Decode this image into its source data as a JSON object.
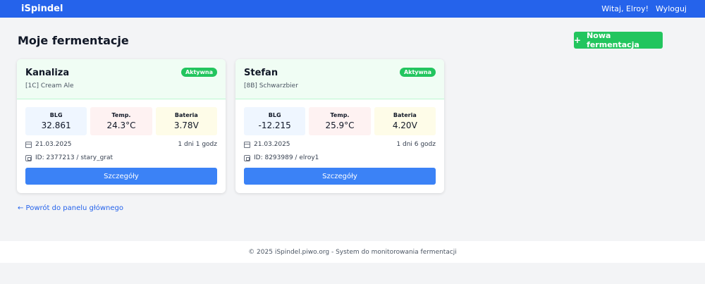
{
  "navbar": {
    "brand": "iSpindel",
    "greeting": "Witaj, Elroy!",
    "logout_label": "Wyloguj"
  },
  "header": {
    "title": "Moje fermentacje",
    "new_button_icon": "+",
    "new_button_label": "Nowa fermentacja"
  },
  "cards": [
    {
      "name": "Kanaliza",
      "style": "[1C] Cream Ale",
      "badge": "Aktywna",
      "metrics": {
        "blg_label": "BLG",
        "blg_value": "32.861",
        "temp_label": "Temp.",
        "temp_value": "24.3°C",
        "battery_label": "Bateria",
        "battery_value": "3.78V"
      },
      "date": "21.03.2025",
      "duration": "1 dni 1 godz",
      "device": "ID: 2377213 / stary_grat",
      "details_label": "Szczegóły"
    },
    {
      "name": "Stefan",
      "style": "[8B] Schwarzbier",
      "badge": "Aktywna",
      "metrics": {
        "blg_label": "BLG",
        "blg_value": "-12.215",
        "temp_label": "Temp.",
        "temp_value": "25.9°C",
        "battery_label": "Bateria",
        "battery_value": "4.20V"
      },
      "date": "21.03.2025",
      "duration": "1 dni 6 godz",
      "device": "ID: 8293989 / elroy1",
      "details_label": "Szczegóły"
    }
  ],
  "back_link": "← Powrót do panelu głównego",
  "footer": "© 2025 iSpindel.piwo.org - System do monitorowania fermentacji",
  "colors": {
    "primary": "#2563eb",
    "success": "#22c55e",
    "button": "#3b82f6"
  },
  "icons": {
    "date": "calendar-icon",
    "device": "chip-icon",
    "new": "plus-icon"
  }
}
